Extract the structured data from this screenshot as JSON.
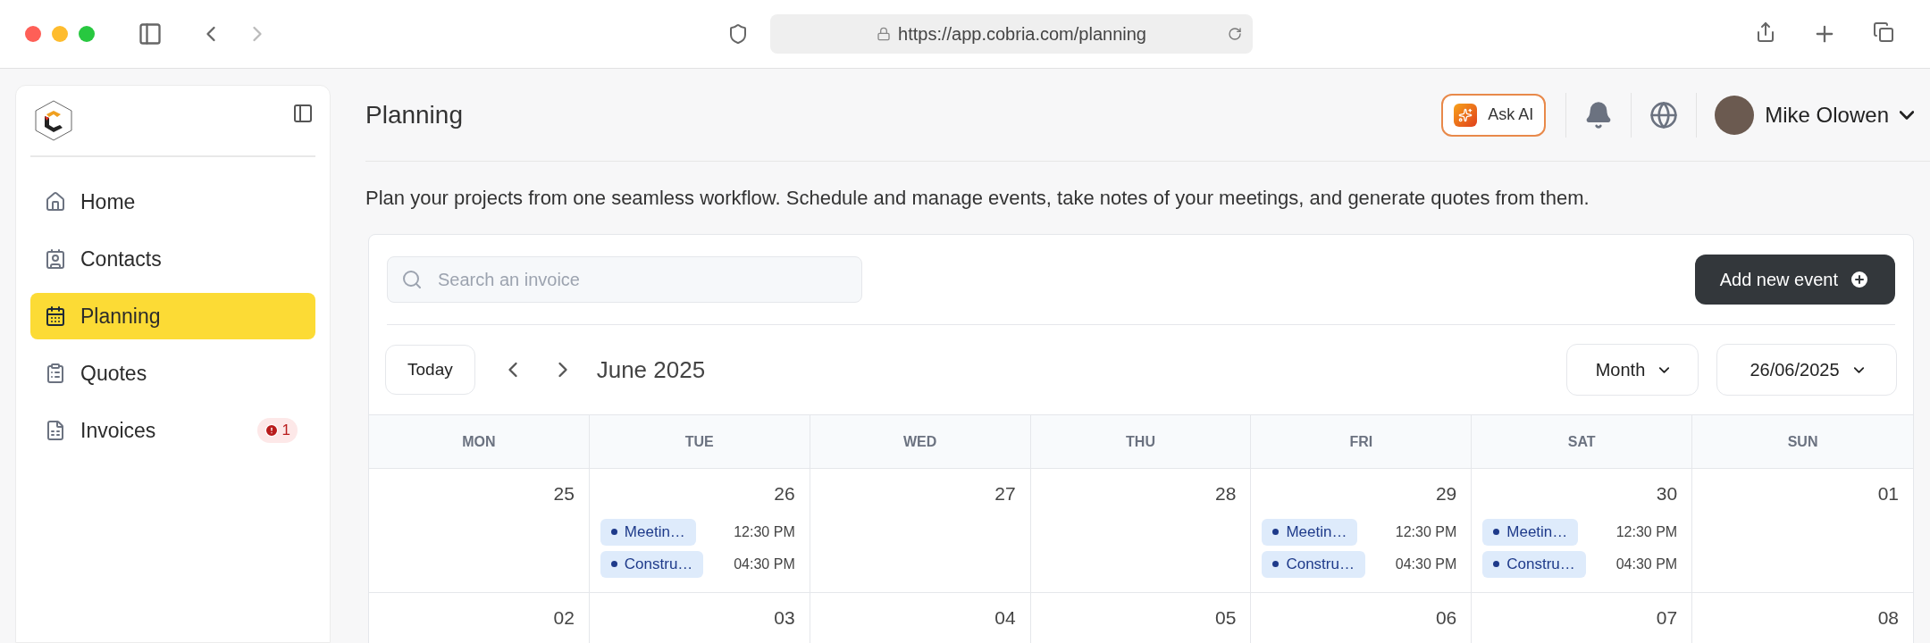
{
  "browser": {
    "url": "https://app.cobria.com/planning"
  },
  "sidebar": {
    "items": [
      {
        "label": "Home",
        "selected": false
      },
      {
        "label": "Contacts",
        "selected": false
      },
      {
        "label": "Planning",
        "selected": true
      },
      {
        "label": "Quotes",
        "selected": false
      },
      {
        "label": "Invoices",
        "selected": false,
        "badge": "1"
      }
    ]
  },
  "header": {
    "title": "Planning",
    "ask_ai": "Ask AI",
    "user": "Mike Olowen"
  },
  "description": "Plan your projects from one seamless workflow. Schedule and manage events, take notes of your meetings,  and generate quotes from them.",
  "search": {
    "placeholder": "Search an invoice"
  },
  "add_button": "Add new event",
  "toolbar": {
    "today": "Today",
    "period": "June 2025",
    "view": "Month",
    "date": "26/06/2025"
  },
  "calendar": {
    "weekdays": [
      "MON",
      "TUE",
      "WED",
      "THU",
      "FRI",
      "SAT",
      "SUN"
    ],
    "weeks": [
      [
        {
          "day": "25"
        },
        {
          "day": "26",
          "events": [
            {
              "title": "Meetin…",
              "time": "12:30 PM"
            },
            {
              "title": "Constru…",
              "time": "04:30 PM"
            }
          ]
        },
        {
          "day": "27"
        },
        {
          "day": "28"
        },
        {
          "day": "29",
          "events": [
            {
              "title": "Meetin…",
              "time": "12:30 PM"
            },
            {
              "title": "Constru…",
              "time": "04:30 PM"
            }
          ]
        },
        {
          "day": "30",
          "events": [
            {
              "title": "Meetin…",
              "time": "12:30 PM"
            },
            {
              "title": "Constru…",
              "time": "04:30 PM"
            }
          ]
        },
        {
          "day": "01"
        }
      ],
      [
        {
          "day": "02"
        },
        {
          "day": "03"
        },
        {
          "day": "04"
        },
        {
          "day": "05"
        },
        {
          "day": "06"
        },
        {
          "day": "07"
        },
        {
          "day": "08"
        }
      ]
    ]
  }
}
